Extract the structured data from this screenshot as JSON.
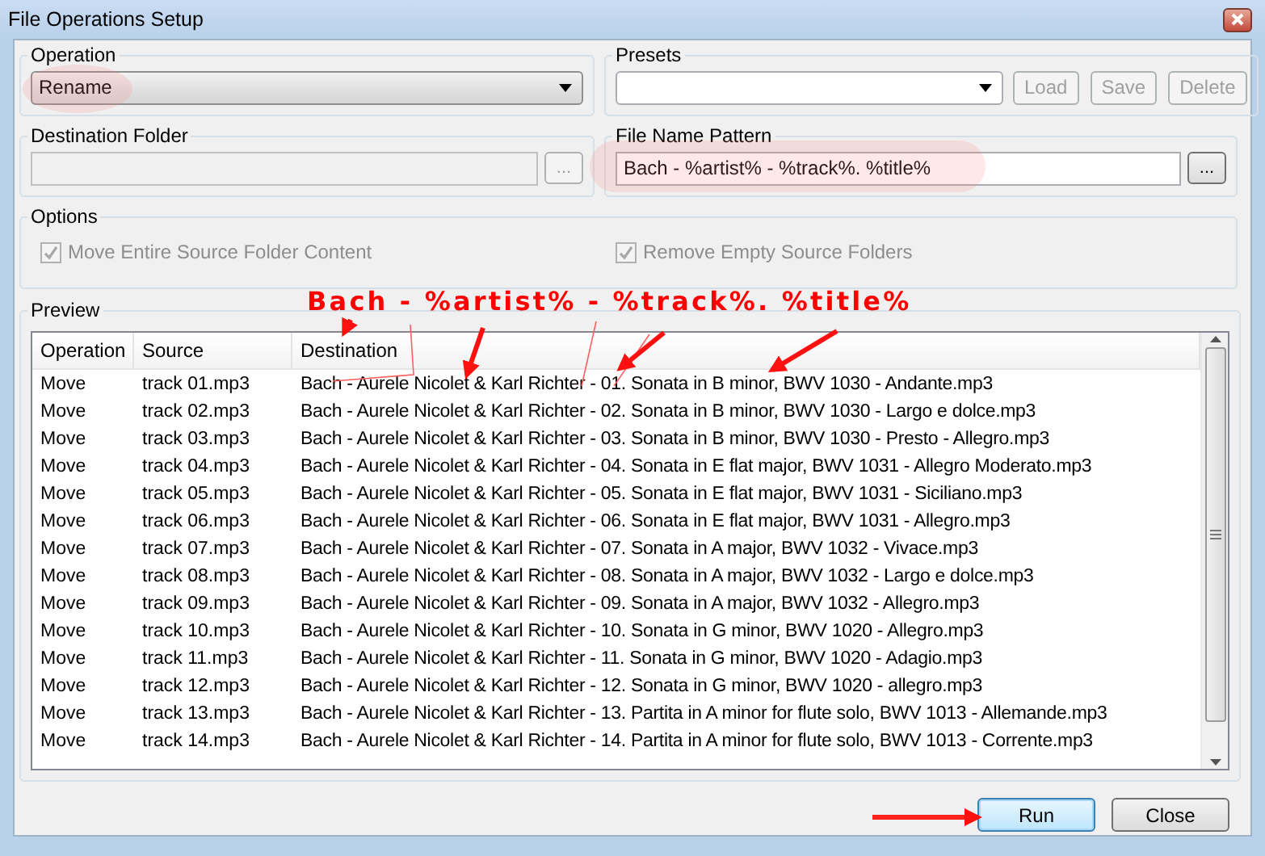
{
  "window": {
    "title": "File Operations Setup"
  },
  "operation": {
    "label": "Operation",
    "value": "Rename"
  },
  "presets": {
    "label": "Presets",
    "buttons": [
      {
        "label": "Load",
        "disabled": true
      },
      {
        "label": "Save",
        "disabled": true
      },
      {
        "label": "Delete",
        "disabled": true
      }
    ]
  },
  "destination_folder": {
    "label": "Destination Folder",
    "disabled": true,
    "browse": "..."
  },
  "file_name_pattern": {
    "label": "File Name Pattern",
    "value": "Bach - %artist% - %track%. %title%",
    "browse": "..."
  },
  "options": {
    "label": "Options",
    "checkboxes": [
      {
        "label": "Move Entire Source Folder Content",
        "checked": true,
        "disabled": true
      },
      {
        "label": "Remove Empty Source Folders",
        "checked": true,
        "disabled": true
      }
    ]
  },
  "preview": {
    "label": "Preview",
    "columns": [
      "Operation",
      "Source",
      "Destination"
    ],
    "rows": [
      {
        "operation": "Move",
        "source": "track 01.mp3",
        "destination": "Bach - Aurele Nicolet & Karl Richter - 01. Sonata in B minor, BWV 1030 - Andante.mp3"
      },
      {
        "operation": "Move",
        "source": "track 02.mp3",
        "destination": "Bach - Aurele Nicolet & Karl Richter - 02. Sonata in B minor, BWV 1030 - Largo e dolce.mp3"
      },
      {
        "operation": "Move",
        "source": "track 03.mp3",
        "destination": "Bach - Aurele Nicolet & Karl Richter - 03. Sonata in B minor, BWV 1030 - Presto - Allegro.mp3"
      },
      {
        "operation": "Move",
        "source": "track 04.mp3",
        "destination": "Bach - Aurele Nicolet & Karl Richter - 04. Sonata in E flat major, BWV 1031 - Allegro Moderato.mp3"
      },
      {
        "operation": "Move",
        "source": "track 05.mp3",
        "destination": "Bach - Aurele Nicolet & Karl Richter - 05. Sonata in E flat major, BWV 1031 - Siciliano.mp3"
      },
      {
        "operation": "Move",
        "source": "track 06.mp3",
        "destination": "Bach - Aurele Nicolet & Karl Richter - 06. Sonata in E flat major, BWV 1031 - Allegro.mp3"
      },
      {
        "operation": "Move",
        "source": "track 07.mp3",
        "destination": "Bach - Aurele Nicolet & Karl Richter - 07. Sonata in A major, BWV 1032 - Vivace.mp3"
      },
      {
        "operation": "Move",
        "source": "track 08.mp3",
        "destination": "Bach - Aurele Nicolet & Karl Richter - 08. Sonata in A major, BWV 1032 - Largo e dolce.mp3"
      },
      {
        "operation": "Move",
        "source": "track 09.mp3",
        "destination": "Bach - Aurele Nicolet & Karl Richter - 09. Sonata in A major, BWV 1032 - Allegro.mp3"
      },
      {
        "operation": "Move",
        "source": "track 10.mp3",
        "destination": "Bach - Aurele Nicolet & Karl Richter - 10. Sonata in G minor, BWV 1020 - Allegro.mp3"
      },
      {
        "operation": "Move",
        "source": "track 11.mp3",
        "destination": "Bach - Aurele Nicolet & Karl Richter - 11. Sonata in G minor, BWV 1020 - Adagio.mp3"
      },
      {
        "operation": "Move",
        "source": "track 12.mp3",
        "destination": "Bach - Aurele Nicolet & Karl Richter - 12. Sonata in G minor, BWV 1020 - allegro.mp3"
      },
      {
        "operation": "Move",
        "source": "track 13.mp3",
        "destination": "Bach - Aurele Nicolet & Karl Richter - 13. Partita in A minor for flute solo, BWV 1013 - Allemande.mp3"
      },
      {
        "operation": "Move",
        "source": "track 14.mp3",
        "destination": "Bach - Aurele Nicolet & Karl Richter - 14. Partita in A minor for flute solo, BWV 1013 - Corrente.mp3"
      }
    ]
  },
  "buttons": [
    {
      "label": "Run",
      "default": true
    },
    {
      "label": "Close",
      "default": false
    }
  ],
  "annotation": {
    "text": "Bach - %artist% - %track%. %title%"
  }
}
